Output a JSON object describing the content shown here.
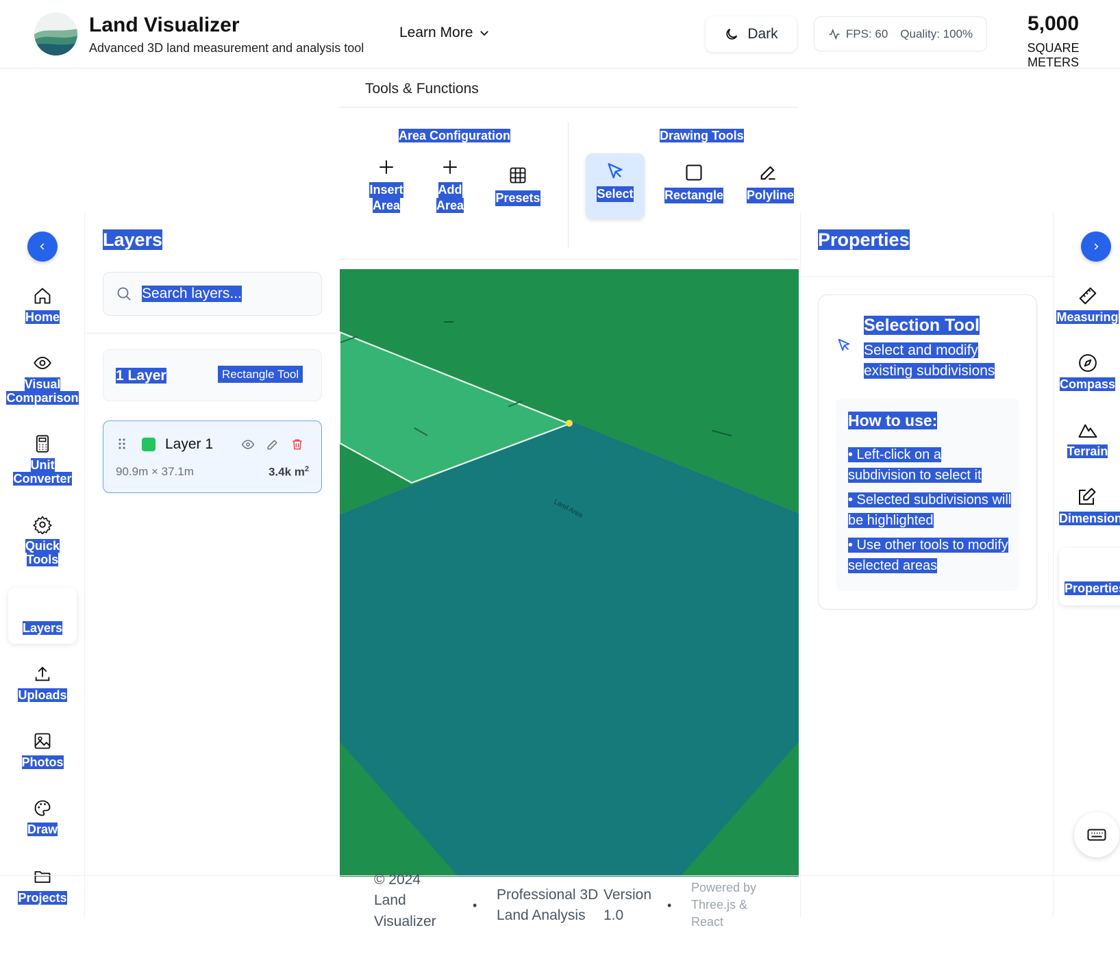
{
  "header": {
    "app_title": "Land Visualizer",
    "app_subtitle": "Advanced 3D land measurement and analysis tool",
    "learn_more": "Learn More",
    "theme_toggle": "Dark",
    "fps": "FPS: 60",
    "quality": "Quality: 100%",
    "area_value": "5,000",
    "area_unit": "SQUARE METERS"
  },
  "toolbar": {
    "title": "Tools & Functions",
    "groups": [
      {
        "title": "Area Configuration",
        "tools": [
          {
            "label_line1": "Insert",
            "label_line2": "Area",
            "icon": "plus-icon"
          },
          {
            "label_line1": "Add",
            "label_line2": "Area",
            "icon": "plus-icon"
          },
          {
            "label_line1": "Presets",
            "label_line2": "",
            "icon": "grid-icon"
          }
        ]
      },
      {
        "title": "Drawing Tools",
        "tools": [
          {
            "label_line1": "Select",
            "label_line2": "",
            "icon": "cursor-icon",
            "active": true
          },
          {
            "label_line1": "Rectangle",
            "label_line2": "",
            "icon": "square-icon"
          },
          {
            "label_line1": "Polyline",
            "label_line2": "",
            "icon": "pencil-icon"
          }
        ]
      }
    ]
  },
  "left_nav": {
    "items": [
      {
        "line1": "Home",
        "line2": "",
        "icon": "home-icon"
      },
      {
        "line1": "Visual",
        "line2": "Comparison",
        "icon": "eye-icon"
      },
      {
        "line1": "Unit",
        "line2": "Converter",
        "icon": "calculator-icon"
      },
      {
        "line1": "Quick",
        "line2": "Tools",
        "icon": "gear-icon"
      },
      {
        "line1": "Layers",
        "line2": "",
        "icon": "layers-icon",
        "active": true
      },
      {
        "line1": "Uploads",
        "line2": "",
        "icon": "upload-icon"
      },
      {
        "line1": "Photos",
        "line2": "",
        "icon": "image-icon"
      },
      {
        "line1": "Draw",
        "line2": "",
        "icon": "palette-icon"
      },
      {
        "line1": "Projects",
        "line2": "",
        "icon": "folder-icon"
      }
    ]
  },
  "layers_panel": {
    "title": "Layers",
    "search_placeholder": "Search layers...",
    "count_label": "1 Layer",
    "tool_badge": "Rectangle Tool",
    "layers": [
      {
        "name": "Layer 1",
        "dims": "90.9m × 37.1m",
        "area": "3.4k m",
        "area_sup": "2",
        "color": "#22c55e"
      }
    ]
  },
  "canvas": {
    "labels": [
      "Land Area"
    ]
  },
  "properties_panel": {
    "title": "Properties",
    "tool_title": "Selection Tool",
    "tool_desc": "Select and modify existing subdivisions",
    "howto_title": "How to use:",
    "howto_items": [
      "• Left-click on a subdivision to select it",
      "• Selected subdivisions will be highlighted",
      "• Use other tools to modify selected areas"
    ]
  },
  "right_nav": {
    "items": [
      {
        "label": "Measuring",
        "icon": "ruler-icon"
      },
      {
        "label": "Compass",
        "icon": "compass-icon"
      },
      {
        "label": "Terrain",
        "icon": "mountain-icon"
      },
      {
        "label": "Dimensions",
        "icon": "edit-icon"
      },
      {
        "label": "Properties",
        "icon": "",
        "active": true
      }
    ]
  },
  "footer": {
    "copyright_l1": "© 2024",
    "copyright_l2": "Land",
    "copyright_l3": "Visualizer",
    "version_l1": "Professional 3D",
    "version_l2": "Land Analysis",
    "version_num_l1": "Version",
    "version_num_l2": "1.0",
    "powered_l1": "Powered by",
    "powered_l2": "Three.js &",
    "powered_l3": "React"
  },
  "colors": {
    "accent": "#2563eb",
    "highlight": "#2f5bd8",
    "grass": "#1f8f4e",
    "land_area": "#167a7a",
    "layer_fill": "#36b473"
  }
}
